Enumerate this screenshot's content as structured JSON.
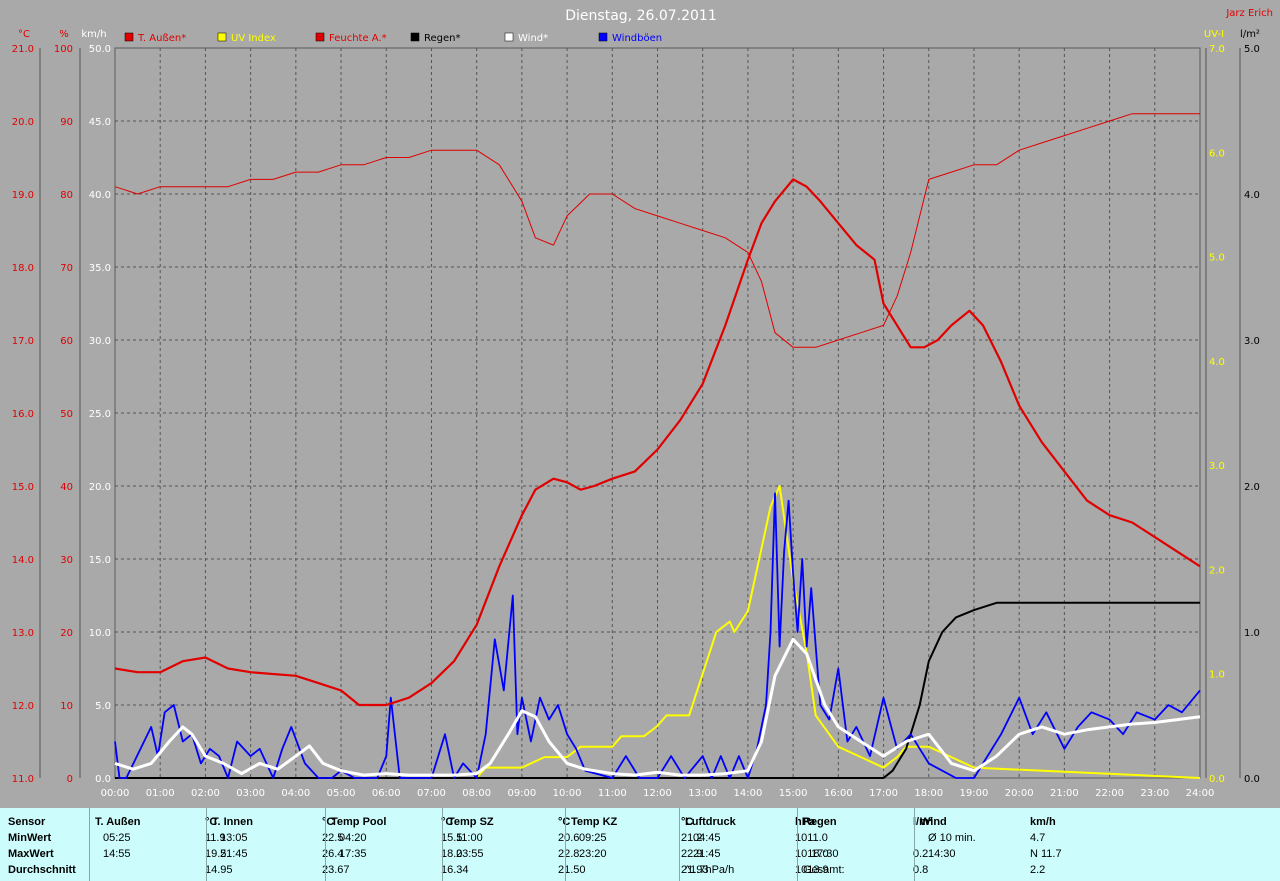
{
  "header": {
    "title": "Dienstag, 26.07.2011",
    "author": "Jarz Erich"
  },
  "colors": {
    "temp": "#e00000",
    "humidity": "#e00000",
    "uv": "#ffff00",
    "rain": "#000000",
    "wind": "#ffffff",
    "gust": "#0000ff",
    "plot_bg": "#a9a9a9",
    "table_bg": "#ccfcfc"
  },
  "chart_data": {
    "type": "line",
    "x": [
      "00:00",
      "01:00",
      "02:00",
      "03:00",
      "04:00",
      "05:00",
      "06:00",
      "07:00",
      "08:00",
      "09:00",
      "10:00",
      "11:00",
      "12:00",
      "13:00",
      "14:00",
      "15:00",
      "16:00",
      "17:00",
      "18:00",
      "19:00",
      "20:00",
      "21:00",
      "22:00",
      "23:00",
      "24:00"
    ],
    "grid": true,
    "legend": [
      {
        "label": "T. Außen*",
        "color": "#e00000"
      },
      {
        "label": "UV Index",
        "color": "#ffff00"
      },
      {
        "label": "Feuchte A.*",
        "color": "#e00000"
      },
      {
        "label": "Regen*",
        "color": "#000000"
      },
      {
        "label": "Wind*",
        "color": "#ffffff"
      },
      {
        "label": "Windböen",
        "color": "#0000ff"
      }
    ],
    "axes": {
      "temp": {
        "unit": "°C",
        "range": [
          11.0,
          21.0
        ],
        "ticks": [
          "11.0",
          "12.0",
          "13.0",
          "14.0",
          "15.0",
          "16.0",
          "17.0",
          "18.0",
          "19.0",
          "20.0",
          "21.0"
        ]
      },
      "humidity": {
        "unit": "%",
        "range": [
          0,
          100
        ],
        "ticks": [
          "0",
          "10",
          "20",
          "30",
          "40",
          "50",
          "60",
          "70",
          "80",
          "90",
          "100"
        ]
      },
      "wind": {
        "unit": "km/h",
        "range": [
          0,
          50
        ],
        "ticks": [
          "0.0",
          "5.0",
          "10.0",
          "15.0",
          "20.0",
          "25.0",
          "30.0",
          "35.0",
          "40.0",
          "45.0",
          "50.0"
        ]
      },
      "uv": {
        "unit": "UV-I",
        "range": [
          0,
          7
        ],
        "ticks": [
          "0.0",
          "1.0",
          "2.0",
          "3.0",
          "4.0",
          "5.0",
          "6.0",
          "7.0"
        ]
      },
      "rain": {
        "unit": "l/m²",
        "range": [
          0,
          5
        ],
        "ticks": [
          "0.0",
          "1.0",
          "2.0",
          "3.0",
          "4.0",
          "5.0"
        ]
      }
    },
    "series": [
      {
        "name": "T. Außen*",
        "axis": "temp",
        "x": [
          0,
          0.5,
          1,
          1.5,
          2,
          2.5,
          3,
          4,
          4.5,
          5,
          5.4,
          6,
          6.5,
          7,
          7.5,
          8,
          8.5,
          9,
          9.3,
          9.7,
          10,
          10.3,
          10.6,
          11,
          11.5,
          12,
          12.5,
          13,
          13.5,
          14,
          14.3,
          14.6,
          15,
          15.3,
          15.6,
          16,
          16.4,
          16.8,
          17,
          17.3,
          17.6,
          17.9,
          18.2,
          18.5,
          18.9,
          19.2,
          19.6,
          20,
          20.5,
          21,
          21.5,
          22,
          22.5,
          23,
          23.5,
          24
        ],
        "y": [
          12.5,
          12.45,
          12.45,
          12.6,
          12.65,
          12.5,
          12.45,
          12.4,
          12.3,
          12.2,
          12.0,
          12.0,
          12.1,
          12.3,
          12.6,
          13.1,
          13.9,
          14.6,
          14.95,
          15.1,
          15.05,
          14.95,
          15.0,
          15.1,
          15.2,
          15.5,
          15.9,
          16.4,
          17.2,
          18.1,
          18.6,
          18.9,
          19.2,
          19.1,
          18.9,
          18.6,
          18.3,
          18.1,
          17.5,
          17.2,
          16.9,
          16.9,
          17.0,
          17.2,
          17.4,
          17.2,
          16.7,
          16.1,
          15.6,
          15.2,
          14.8,
          14.6,
          14.5,
          14.3,
          14.1,
          13.9
        ]
      },
      {
        "name": "Feuchte A.*",
        "axis": "humidity",
        "x": [
          0,
          0.5,
          1,
          1.5,
          2,
          2.5,
          3,
          3.5,
          4,
          4.5,
          5,
          5.5,
          6,
          6.5,
          7,
          7.5,
          8,
          8.5,
          9,
          9.3,
          9.7,
          10,
          10.5,
          11,
          11.5,
          12,
          12.5,
          13,
          13.5,
          14,
          14.3,
          14.6,
          15,
          15.5,
          16,
          16.5,
          17,
          17.3,
          17.6,
          18,
          18.5,
          19,
          19.5,
          20,
          20.5,
          21,
          21.5,
          22,
          22.5,
          23,
          23.5,
          24
        ],
        "y": [
          81,
          80,
          81,
          81,
          81,
          81,
          82,
          82,
          83,
          83,
          84,
          84,
          85,
          85,
          86,
          86,
          86,
          84,
          79,
          74,
          73,
          77,
          80,
          80,
          78,
          77,
          76,
          75,
          74,
          72,
          68,
          61,
          59,
          59,
          60,
          61,
          62,
          66,
          72,
          82,
          83,
          84,
          84,
          86,
          87,
          88,
          89,
          90,
          91,
          91,
          91,
          91
        ]
      },
      {
        "name": "UV Index",
        "axis": "uv",
        "x": [
          0,
          8,
          8.2,
          9,
          9.5,
          10,
          10.3,
          11,
          11.2,
          11.7,
          12,
          12.2,
          12.7,
          13,
          13.3,
          13.6,
          13.7,
          14,
          14.5,
          14.7,
          15,
          15.3,
          15.5,
          16,
          16.5,
          17,
          17.3,
          17.5,
          18,
          18.5,
          19,
          24
        ],
        "y": [
          0,
          0,
          0.1,
          0.1,
          0.2,
          0.2,
          0.3,
          0.3,
          0.4,
          0.4,
          0.5,
          0.6,
          0.6,
          1.0,
          1.4,
          1.5,
          1.4,
          1.6,
          2.6,
          2.8,
          1.9,
          1.2,
          0.6,
          0.3,
          0.2,
          0.1,
          0.2,
          0.3,
          0.3,
          0.2,
          0.1,
          0
        ]
      },
      {
        "name": "Regen*",
        "axis": "rain",
        "x": [
          0,
          17,
          17.2,
          17.5,
          17.8,
          18,
          18.3,
          18.6,
          19,
          19.5,
          24
        ],
        "y": [
          0,
          0,
          0.05,
          0.2,
          0.5,
          0.8,
          1.0,
          1.1,
          1.15,
          1.2,
          1.2
        ]
      },
      {
        "name": "Wind*",
        "axis": "wind",
        "x": [
          0,
          0.4,
          0.8,
          1.2,
          1.5,
          1.7,
          2,
          2.4,
          2.8,
          3.2,
          3.6,
          4,
          4.3,
          4.6,
          5,
          5.5,
          6,
          6.5,
          7,
          7.5,
          8,
          8.3,
          8.7,
          9,
          9.3,
          9.6,
          10,
          10.4,
          11,
          11.5,
          12,
          12.5,
          13,
          13.5,
          14,
          14.3,
          14.6,
          15,
          15.3,
          15.7,
          16,
          16.5,
          17,
          17.5,
          18,
          18.5,
          19,
          19.5,
          20,
          20.5,
          21,
          21.5,
          22,
          22.5,
          23,
          23.5,
          24
        ],
        "y": [
          1.0,
          0.6,
          1.0,
          2.5,
          3.5,
          3.0,
          1.5,
          1.0,
          0.3,
          1.0,
          0.6,
          1.5,
          2.2,
          1.0,
          0.5,
          0.2,
          0.3,
          0.2,
          0.2,
          0.2,
          0.3,
          1.0,
          3.0,
          4.6,
          4.2,
          2.5,
          1.0,
          0.6,
          0.3,
          0.2,
          0.4,
          0.2,
          0.2,
          0.3,
          0.5,
          2.5,
          7.0,
          9.5,
          8.5,
          5.0,
          3.5,
          2.5,
          1.5,
          2.5,
          3.0,
          1.0,
          0.5,
          1.5,
          3.0,
          3.5,
          3.0,
          3.3,
          3.5,
          3.7,
          3.8,
          4.0,
          4.2
        ]
      },
      {
        "name": "Windböen",
        "axis": "wind",
        "x": [
          0,
          0.1,
          0.25,
          0.8,
          0.95,
          1.1,
          1.3,
          1.5,
          1.7,
          1.9,
          2.1,
          2.3,
          2.5,
          2.7,
          3.0,
          3.2,
          3.5,
          3.7,
          3.9,
          4.2,
          4.5,
          4.8,
          5.0,
          5.3,
          5.6,
          5.8,
          6.0,
          6.1,
          6.3,
          7.0,
          7.3,
          7.5,
          7.7,
          8.0,
          8.2,
          8.4,
          8.6,
          8.8,
          8.9,
          9.0,
          9.2,
          9.4,
          9.6,
          9.8,
          10.0,
          10.2,
          10.4,
          11.0,
          11.3,
          11.6,
          12.0,
          12.3,
          12.6,
          13.0,
          13.2,
          13.4,
          13.6,
          13.8,
          14.0,
          14.2,
          14.4,
          14.5,
          14.6,
          14.7,
          14.8,
          14.9,
          15.0,
          15.1,
          15.2,
          15.3,
          15.4,
          15.6,
          15.8,
          16.0,
          16.2,
          16.4,
          16.7,
          17.0,
          17.3,
          17.6,
          18.0,
          18.3,
          18.6,
          19.0,
          19.3,
          19.6,
          20.0,
          20.3,
          20.6,
          21.0,
          21.3,
          21.6,
          22.0,
          22.3,
          22.6,
          23.0,
          23.3,
          23.6,
          24.0
        ],
        "y": [
          2.5,
          0,
          0,
          3.5,
          1.5,
          4.5,
          5.0,
          2.5,
          3.0,
          1.0,
          2.0,
          1.5,
          0,
          2.5,
          1.5,
          2.0,
          0,
          2.0,
          3.5,
          1.0,
          0,
          0,
          0.5,
          0,
          0,
          0,
          1.5,
          5.5,
          0,
          0,
          3.0,
          0,
          1.0,
          0,
          3.0,
          9.5,
          6.0,
          12.5,
          3.0,
          5.5,
          2.5,
          5.5,
          4.0,
          5.0,
          3.0,
          2.0,
          0.5,
          0,
          1.5,
          0,
          0,
          1.5,
          0,
          1.5,
          0,
          1.5,
          0,
          1.5,
          0,
          2.0,
          5.0,
          10.0,
          19.5,
          9.0,
          15.5,
          19.0,
          14.0,
          10.0,
          15.0,
          9.0,
          13.0,
          5.0,
          4.0,
          7.5,
          2.5,
          3.5,
          1.5,
          5.5,
          2.0,
          3.0,
          1.0,
          0.5,
          0,
          0,
          1.5,
          3.0,
          5.5,
          3.0,
          4.5,
          2.0,
          3.5,
          4.5,
          4.0,
          3.0,
          4.5,
          4.0,
          5.0,
          4.5,
          6.0
        ]
      }
    ]
  },
  "table": {
    "columns": [
      {
        "title": "T. Außen",
        "unit": "°C",
        "min_time": "05:25",
        "min": "11.9",
        "max_time": "14:55",
        "max": "19.5",
        "avg": "14.95"
      },
      {
        "title": "T. Innen",
        "unit": "°C",
        "min_time": "13:05",
        "min": "22.5",
        "max_time": "21:45",
        "max": "26.4",
        "avg": "23.67"
      },
      {
        "title": "Temp Pool",
        "unit": "°C",
        "min_time": "04:20",
        "min": "15.5",
        "max_time": "17:35",
        "max": "18.0",
        "avg": "16.34"
      },
      {
        "title": "Temp SZ",
        "unit": "°C",
        "min_time": "11:00",
        "min": "20.6",
        "max_time": "23:55",
        "max": "22.8",
        "avg": "21.50"
      },
      {
        "title": "Temp KZ",
        "unit": "°C",
        "min_time": "09:25",
        "min": "21.2",
        "max_time": "23:20",
        "max": "22.9",
        "avg": "21.93"
      },
      {
        "title": "Luftdruck",
        "unit": "hPa",
        "min_time": "04:45",
        "min": "1011.0",
        "max_time": "21:45",
        "max": "1018.0",
        "avg_label": "^1.7hPa/h",
        "avg": "1013.9"
      },
      {
        "title": "Regen",
        "unit": "l/m²",
        "min_time": "",
        "min": "",
        "max_time": "17:30",
        "max": "0.2",
        "avg_label": "Gesamt:",
        "avg": "0.8"
      },
      {
        "title": "Wind",
        "unit": "km/h",
        "min_time": "Ø 10 min.",
        "min": "4.7",
        "max_time": "14:30",
        "max": "N 11.7",
        "avg": "2.2"
      }
    ],
    "row_labels": {
      "header": "Sensor",
      "min": "MinWert",
      "max": "MaxWert",
      "avg": "Durchschnitt"
    }
  }
}
